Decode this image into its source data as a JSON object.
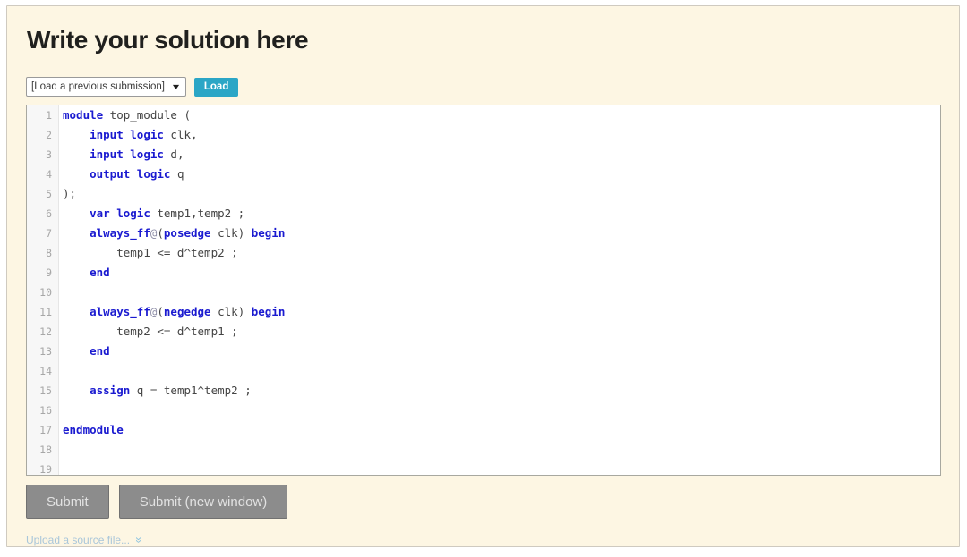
{
  "page": {
    "title": "Write your solution here",
    "background_color": "#fdf6e3",
    "border_color": "#cfcac0"
  },
  "load_row": {
    "select_value": "[Load a previous submission]",
    "select_caret_icon": "chevron-down-icon",
    "load_button_label": "Load",
    "load_button_color": "#2ba6c6"
  },
  "editor": {
    "background_color": "#ffffff",
    "gutter_color": "#f7f7f7",
    "keyword_color": "#1a1ad0",
    "text_color": "#444444",
    "line_number_color": "#a7a7a7",
    "total_lines": 19,
    "lines": [
      {
        "n": "1",
        "tokens": [
          {
            "t": "module",
            "c": "kw"
          },
          {
            "t": " top_module (",
            "c": "pl"
          }
        ]
      },
      {
        "n": "2",
        "tokens": [
          {
            "t": "    ",
            "c": "pl"
          },
          {
            "t": "input logic",
            "c": "kw"
          },
          {
            "t": " clk,",
            "c": "pl"
          }
        ]
      },
      {
        "n": "3",
        "tokens": [
          {
            "t": "    ",
            "c": "pl"
          },
          {
            "t": "input logic",
            "c": "kw"
          },
          {
            "t": " d,",
            "c": "pl"
          }
        ]
      },
      {
        "n": "4",
        "tokens": [
          {
            "t": "    ",
            "c": "pl"
          },
          {
            "t": "output logic",
            "c": "kw"
          },
          {
            "t": " q",
            "c": "pl"
          }
        ]
      },
      {
        "n": "5",
        "tokens": [
          {
            "t": ");",
            "c": "pl"
          }
        ]
      },
      {
        "n": "6",
        "tokens": [
          {
            "t": "    ",
            "c": "pl"
          },
          {
            "t": "var logic",
            "c": "kw"
          },
          {
            "t": " temp1,temp2 ;",
            "c": "pl"
          }
        ]
      },
      {
        "n": "7",
        "tokens": [
          {
            "t": "    ",
            "c": "pl"
          },
          {
            "t": "always_ff",
            "c": "kw"
          },
          {
            "t": "@",
            "c": "at"
          },
          {
            "t": "(",
            "c": "pl"
          },
          {
            "t": "posedge",
            "c": "kw"
          },
          {
            "t": " clk) ",
            "c": "pl"
          },
          {
            "t": "begin",
            "c": "kw"
          }
        ]
      },
      {
        "n": "8",
        "tokens": [
          {
            "t": "        temp1 <= d^temp2 ;",
            "c": "pl"
          }
        ]
      },
      {
        "n": "9",
        "tokens": [
          {
            "t": "    ",
            "c": "pl"
          },
          {
            "t": "end",
            "c": "kw"
          }
        ]
      },
      {
        "n": "10",
        "tokens": []
      },
      {
        "n": "11",
        "tokens": [
          {
            "t": "    ",
            "c": "pl"
          },
          {
            "t": "always_ff",
            "c": "kw"
          },
          {
            "t": "@",
            "c": "at"
          },
          {
            "t": "(",
            "c": "pl"
          },
          {
            "t": "negedge",
            "c": "kw"
          },
          {
            "t": " clk) ",
            "c": "pl"
          },
          {
            "t": "begin",
            "c": "kw"
          }
        ]
      },
      {
        "n": "12",
        "tokens": [
          {
            "t": "        temp2 <= d^temp1 ;",
            "c": "pl"
          }
        ]
      },
      {
        "n": "13",
        "tokens": [
          {
            "t": "    ",
            "c": "pl"
          },
          {
            "t": "end",
            "c": "kw"
          }
        ]
      },
      {
        "n": "14",
        "tokens": []
      },
      {
        "n": "15",
        "tokens": [
          {
            "t": "    ",
            "c": "pl"
          },
          {
            "t": "assign",
            "c": "kw"
          },
          {
            "t": " q = temp1^temp2 ;",
            "c": "pl"
          }
        ]
      },
      {
        "n": "16",
        "tokens": []
      },
      {
        "n": "17",
        "tokens": [
          {
            "t": "endmodule",
            "c": "kw"
          }
        ]
      },
      {
        "n": "18",
        "tokens": []
      },
      {
        "n": "19",
        "tokens": []
      }
    ]
  },
  "buttons": {
    "submit_label": "Submit",
    "submit_new_window_label": "Submit (new window)",
    "color": "#8c8c8c",
    "text_color": "#e2e2e2"
  },
  "upload": {
    "label": "Upload a source file...",
    "chevron_icon": "double-chevron-down-icon",
    "color": "#a9c6da"
  }
}
